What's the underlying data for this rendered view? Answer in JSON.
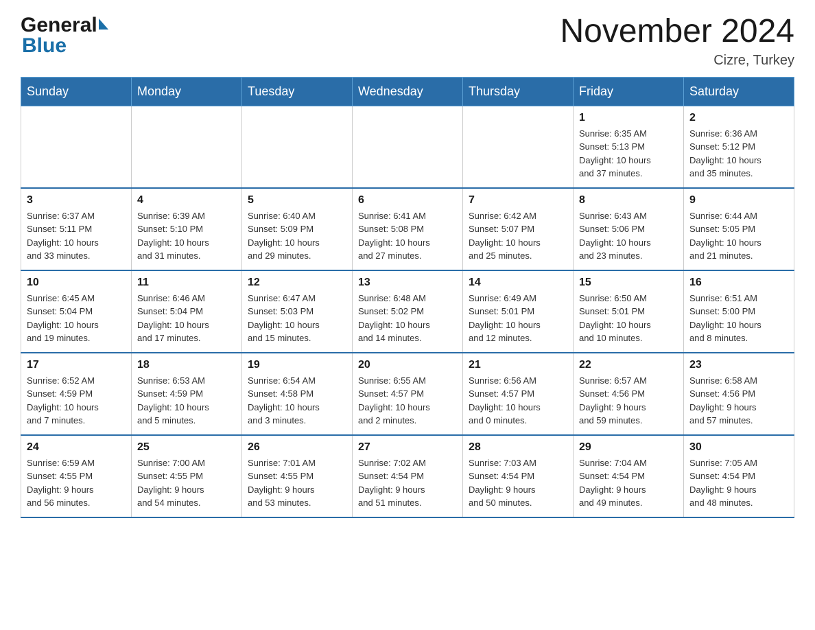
{
  "header": {
    "logo_general": "General",
    "logo_blue": "Blue",
    "month_title": "November 2024",
    "location": "Cizre, Turkey"
  },
  "days_of_week": [
    "Sunday",
    "Monday",
    "Tuesday",
    "Wednesday",
    "Thursday",
    "Friday",
    "Saturday"
  ],
  "weeks": [
    [
      {
        "num": "",
        "info": ""
      },
      {
        "num": "",
        "info": ""
      },
      {
        "num": "",
        "info": ""
      },
      {
        "num": "",
        "info": ""
      },
      {
        "num": "",
        "info": ""
      },
      {
        "num": "1",
        "info": "Sunrise: 6:35 AM\nSunset: 5:13 PM\nDaylight: 10 hours\nand 37 minutes."
      },
      {
        "num": "2",
        "info": "Sunrise: 6:36 AM\nSunset: 5:12 PM\nDaylight: 10 hours\nand 35 minutes."
      }
    ],
    [
      {
        "num": "3",
        "info": "Sunrise: 6:37 AM\nSunset: 5:11 PM\nDaylight: 10 hours\nand 33 minutes."
      },
      {
        "num": "4",
        "info": "Sunrise: 6:39 AM\nSunset: 5:10 PM\nDaylight: 10 hours\nand 31 minutes."
      },
      {
        "num": "5",
        "info": "Sunrise: 6:40 AM\nSunset: 5:09 PM\nDaylight: 10 hours\nand 29 minutes."
      },
      {
        "num": "6",
        "info": "Sunrise: 6:41 AM\nSunset: 5:08 PM\nDaylight: 10 hours\nand 27 minutes."
      },
      {
        "num": "7",
        "info": "Sunrise: 6:42 AM\nSunset: 5:07 PM\nDaylight: 10 hours\nand 25 minutes."
      },
      {
        "num": "8",
        "info": "Sunrise: 6:43 AM\nSunset: 5:06 PM\nDaylight: 10 hours\nand 23 minutes."
      },
      {
        "num": "9",
        "info": "Sunrise: 6:44 AM\nSunset: 5:05 PM\nDaylight: 10 hours\nand 21 minutes."
      }
    ],
    [
      {
        "num": "10",
        "info": "Sunrise: 6:45 AM\nSunset: 5:04 PM\nDaylight: 10 hours\nand 19 minutes."
      },
      {
        "num": "11",
        "info": "Sunrise: 6:46 AM\nSunset: 5:04 PM\nDaylight: 10 hours\nand 17 minutes."
      },
      {
        "num": "12",
        "info": "Sunrise: 6:47 AM\nSunset: 5:03 PM\nDaylight: 10 hours\nand 15 minutes."
      },
      {
        "num": "13",
        "info": "Sunrise: 6:48 AM\nSunset: 5:02 PM\nDaylight: 10 hours\nand 14 minutes."
      },
      {
        "num": "14",
        "info": "Sunrise: 6:49 AM\nSunset: 5:01 PM\nDaylight: 10 hours\nand 12 minutes."
      },
      {
        "num": "15",
        "info": "Sunrise: 6:50 AM\nSunset: 5:01 PM\nDaylight: 10 hours\nand 10 minutes."
      },
      {
        "num": "16",
        "info": "Sunrise: 6:51 AM\nSunset: 5:00 PM\nDaylight: 10 hours\nand 8 minutes."
      }
    ],
    [
      {
        "num": "17",
        "info": "Sunrise: 6:52 AM\nSunset: 4:59 PM\nDaylight: 10 hours\nand 7 minutes."
      },
      {
        "num": "18",
        "info": "Sunrise: 6:53 AM\nSunset: 4:59 PM\nDaylight: 10 hours\nand 5 minutes."
      },
      {
        "num": "19",
        "info": "Sunrise: 6:54 AM\nSunset: 4:58 PM\nDaylight: 10 hours\nand 3 minutes."
      },
      {
        "num": "20",
        "info": "Sunrise: 6:55 AM\nSunset: 4:57 PM\nDaylight: 10 hours\nand 2 minutes."
      },
      {
        "num": "21",
        "info": "Sunrise: 6:56 AM\nSunset: 4:57 PM\nDaylight: 10 hours\nand 0 minutes."
      },
      {
        "num": "22",
        "info": "Sunrise: 6:57 AM\nSunset: 4:56 PM\nDaylight: 9 hours\nand 59 minutes."
      },
      {
        "num": "23",
        "info": "Sunrise: 6:58 AM\nSunset: 4:56 PM\nDaylight: 9 hours\nand 57 minutes."
      }
    ],
    [
      {
        "num": "24",
        "info": "Sunrise: 6:59 AM\nSunset: 4:55 PM\nDaylight: 9 hours\nand 56 minutes."
      },
      {
        "num": "25",
        "info": "Sunrise: 7:00 AM\nSunset: 4:55 PM\nDaylight: 9 hours\nand 54 minutes."
      },
      {
        "num": "26",
        "info": "Sunrise: 7:01 AM\nSunset: 4:55 PM\nDaylight: 9 hours\nand 53 minutes."
      },
      {
        "num": "27",
        "info": "Sunrise: 7:02 AM\nSunset: 4:54 PM\nDaylight: 9 hours\nand 51 minutes."
      },
      {
        "num": "28",
        "info": "Sunrise: 7:03 AM\nSunset: 4:54 PM\nDaylight: 9 hours\nand 50 minutes."
      },
      {
        "num": "29",
        "info": "Sunrise: 7:04 AM\nSunset: 4:54 PM\nDaylight: 9 hours\nand 49 minutes."
      },
      {
        "num": "30",
        "info": "Sunrise: 7:05 AM\nSunset: 4:54 PM\nDaylight: 9 hours\nand 48 minutes."
      }
    ]
  ]
}
